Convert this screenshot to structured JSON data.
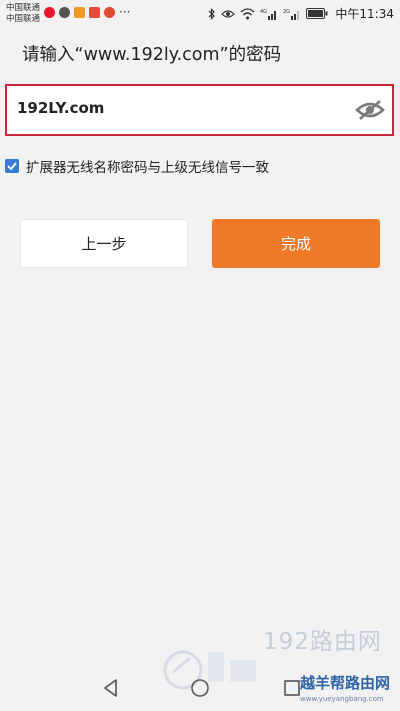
{
  "status_bar": {
    "carrier_1": "中国联通",
    "carrier_2": "中国联通",
    "more": "···",
    "clock": "中午11:34",
    "signal_label_1": "4G",
    "signal_label_2": "2G",
    "icons": [
      "weibo-icon",
      "wechat-icon",
      "app-icon",
      "app-icon",
      "weibo-icon",
      "bluetooth-icon",
      "eye-icon",
      "wifi-icon",
      "signal-icon",
      "signal-icon",
      "battery-icon"
    ]
  },
  "header": {
    "title": "请输入“www.192ly.com”的密码"
  },
  "password": {
    "value": "192LY.com",
    "toggle_icon": "eye-hidden-icon"
  },
  "checkbox": {
    "checked": true,
    "label": "扩展器无线名称密码与上级无线信号一致"
  },
  "buttons": {
    "prev_label": "上一步",
    "done_label": "完成",
    "done_color": "#f07a2a"
  },
  "watermark": {
    "title": "192路由网",
    "tag": "越羊帮路由网",
    "url": "www.yueyangbang.com"
  },
  "nav_bar": {
    "icons": [
      "back-triangle-icon",
      "home-circle-icon",
      "recent-square-icon"
    ]
  },
  "colors": {
    "accent": "#f07a2a",
    "highlight_border": "#c82838",
    "checkbox": "#3a7bd5",
    "background": "#f2f2f2"
  }
}
